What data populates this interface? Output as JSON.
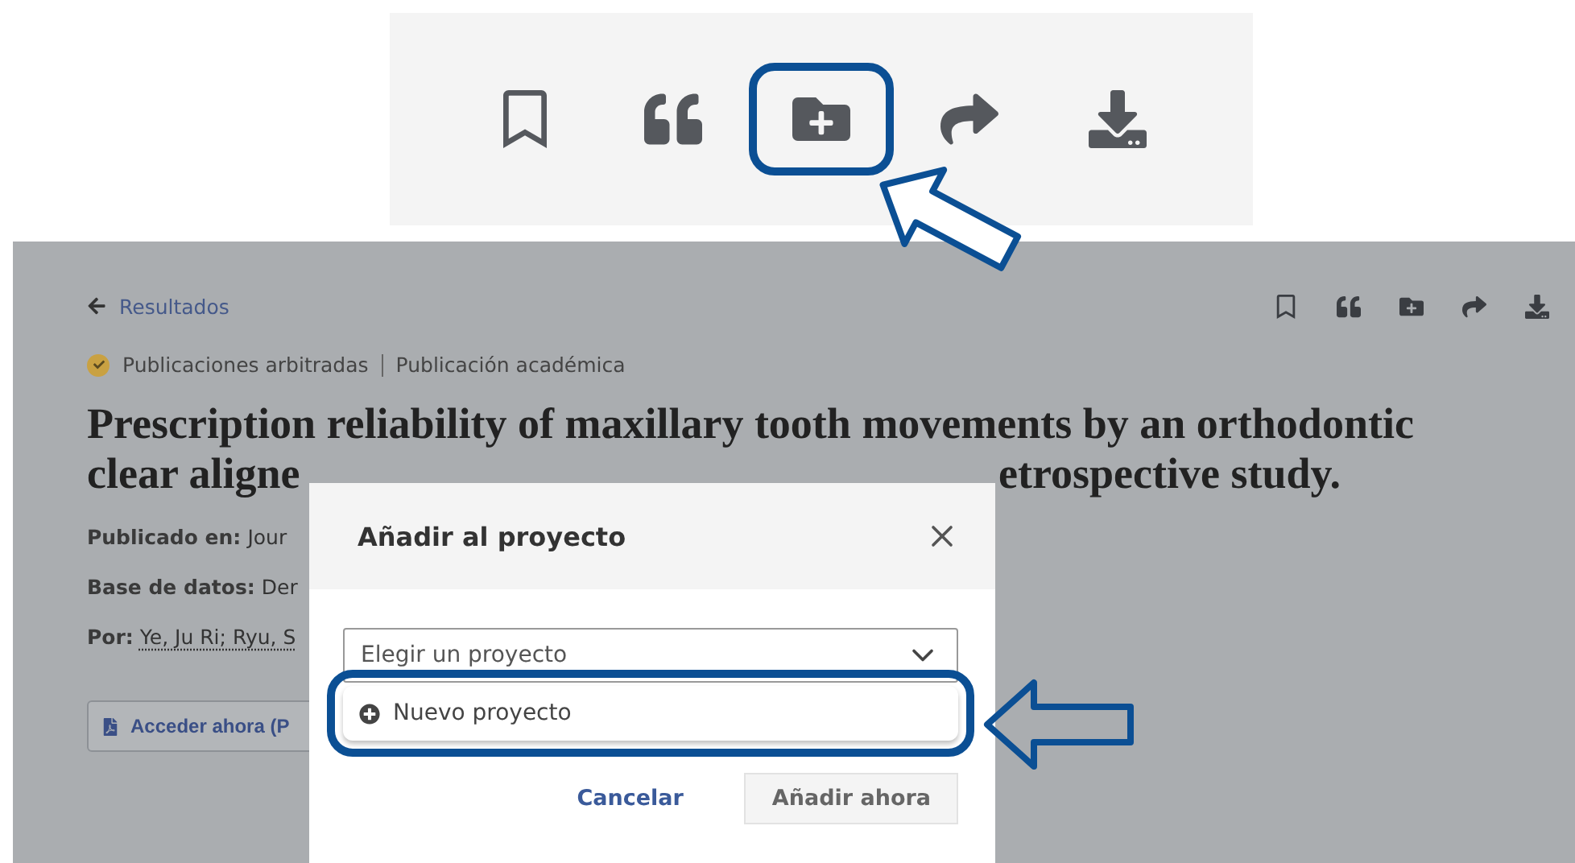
{
  "toolbar_closeup": {
    "actions": [
      {
        "kind": "bookmark",
        "highlighted": false
      },
      {
        "kind": "cite",
        "highlighted": false
      },
      {
        "kind": "add-to-project",
        "highlighted": true
      },
      {
        "kind": "share",
        "highlighted": false
      },
      {
        "kind": "download",
        "highlighted": false
      }
    ]
  },
  "article": {
    "back_link": "Resultados",
    "toolbar": [
      {
        "kind": "bookmark"
      },
      {
        "kind": "cite"
      },
      {
        "kind": "add-to-project"
      },
      {
        "kind": "share"
      },
      {
        "kind": "download"
      }
    ],
    "badges": [
      "Publicaciones arbitradas",
      "Publicación académica"
    ],
    "title_line_1": "Prescription reliability of maxillary tooth movements by an orthodontic",
    "title_line_2_left": "clear aligne",
    "title_line_2_right": "etrospective study.",
    "meta": [
      {
        "label": "Publicado en:",
        "value": "Jour",
        "underlined": false
      },
      {
        "label": "Base de datos:",
        "value": "Der",
        "underlined": false
      },
      {
        "label": "Por:",
        "value": "Ye, Ju Ri; Ryu, S",
        "underlined": true
      }
    ],
    "access_button": "Acceder ahora (P"
  },
  "dialog": {
    "title": "Añadir al proyecto",
    "select": {
      "placeholder": "Elegir un proyecto",
      "expanded": true,
      "options": [
        {
          "label": "Nuevo proyecto",
          "highlighted": true
        }
      ]
    },
    "buttons": [
      {
        "label": "Cancelar",
        "kind": "link",
        "disabled": false
      },
      {
        "label": "Añadir ahora",
        "kind": "button",
        "disabled": true
      }
    ]
  }
}
